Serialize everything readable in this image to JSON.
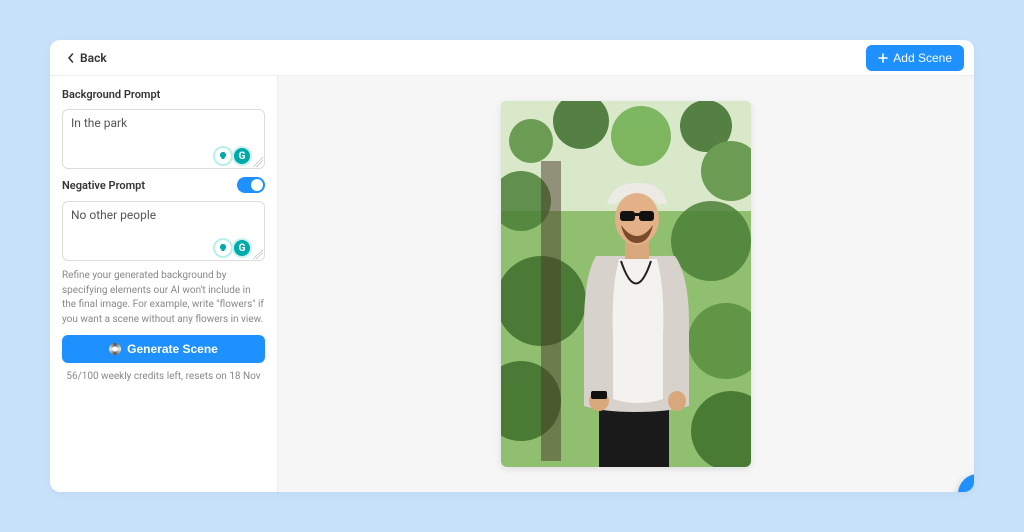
{
  "topbar": {
    "back_label": "Back",
    "add_scene_label": "Add Scene"
  },
  "sidebar": {
    "background_prompt_label": "Background Prompt",
    "background_prompt_value": "In the park",
    "negative_prompt_label": "Negative Prompt",
    "negative_prompt_value": "No other people",
    "negative_toggle_on": true,
    "help_text": "Refine your generated background by specifying elements our AI won't include in the final image. For example, write \"flowers\" if you want a scene without any flowers in view.",
    "generate_label": "Generate Scene",
    "credits_text": "56/100 weekly credits left, resets on 18 Nov",
    "assistant_icon_letter": "G"
  },
  "chat_fab": {
    "name": "chat"
  }
}
